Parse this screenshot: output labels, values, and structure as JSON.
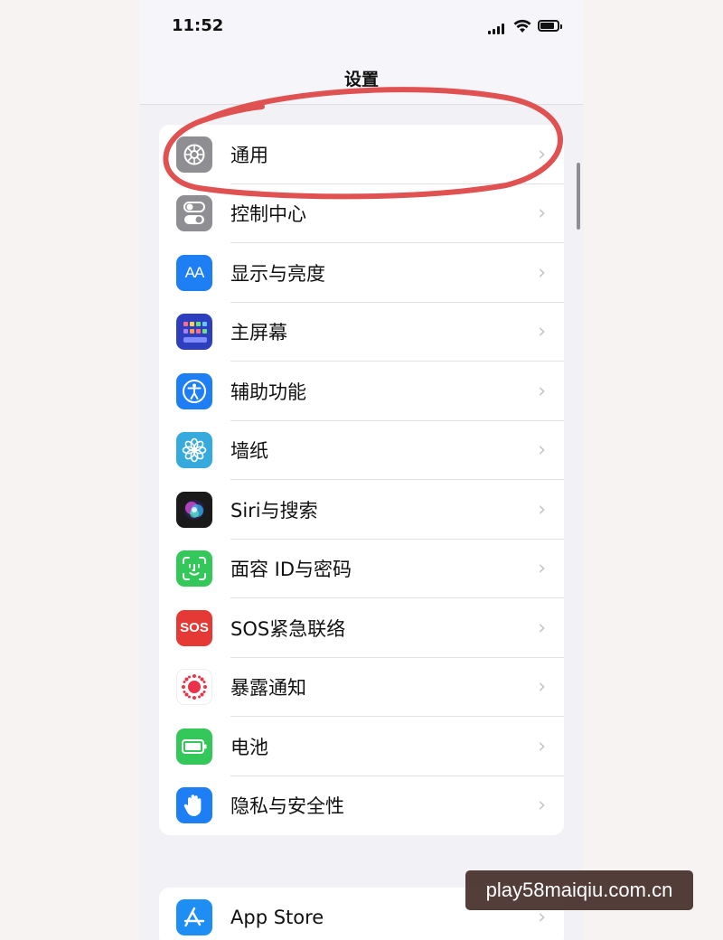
{
  "status_bar": {
    "time": "11:52",
    "icons": [
      "cellular-signal-icon",
      "wifi-icon",
      "battery-icon"
    ]
  },
  "nav": {
    "title": "设置"
  },
  "settings_groups": [
    {
      "items": [
        {
          "label": "通用",
          "icon": "gear-icon",
          "icon_color": "#8e8e93"
        },
        {
          "label": "控制中心",
          "icon": "toggles-icon",
          "icon_color": "#8e8e93"
        },
        {
          "label": "显示与亮度",
          "icon": "text-size-icon",
          "icon_color": "#1e7ff5",
          "icon_text": "AA"
        },
        {
          "label": "主屏幕",
          "icon": "app-grid-icon",
          "icon_color": "#2d3fbf"
        },
        {
          "label": "辅助功能",
          "icon": "accessibility-icon",
          "icon_color": "#1e7ff5"
        },
        {
          "label": "墙纸",
          "icon": "flower-icon",
          "icon_color": "#36aadc"
        },
        {
          "label": "Siri与搜索",
          "icon": "siri-icon",
          "icon_color": "#1a1a1a"
        },
        {
          "label": "面容 ID与密码",
          "icon": "face-id-icon",
          "icon_color": "#34c759"
        },
        {
          "label": "SOS紧急联络",
          "icon": "sos-icon",
          "icon_color": "#e53935",
          "icon_text": "SOS"
        },
        {
          "label": "暴露通知",
          "icon": "exposure-notification-icon",
          "icon_color": "#ffffff"
        },
        {
          "label": "电池",
          "icon": "battery-icon",
          "icon_color": "#34c759"
        },
        {
          "label": "隐私与安全性",
          "icon": "hand-icon",
          "icon_color": "#1e7ff5"
        }
      ]
    },
    {
      "items": [
        {
          "label": "App Store",
          "icon": "app-store-icon",
          "icon_color": "#1e8ef5"
        }
      ]
    }
  ],
  "annotation": {
    "type": "hand-drawn-circle",
    "color": "#e05252",
    "target": "通用"
  },
  "watermark": {
    "text": "play58maiqiu.com.cn"
  }
}
